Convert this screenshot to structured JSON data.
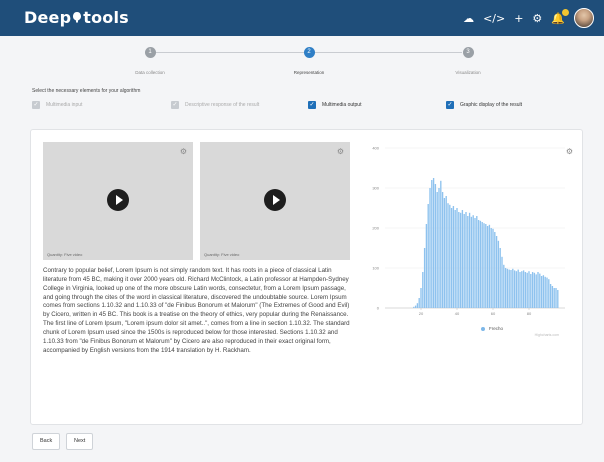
{
  "brand": {
    "name_prefix": "Deep",
    "name_suffix": "tools"
  },
  "topbar": {
    "icons": [
      "cloud-icon",
      "code-icon",
      "plus-icon",
      "settings-icon",
      "bell-icon",
      "avatar"
    ]
  },
  "stepper": {
    "steps": [
      {
        "number": "1",
        "label": "Data collection",
        "state": "done"
      },
      {
        "number": "2",
        "label": "Representation",
        "state": "active"
      },
      {
        "number": "3",
        "label": "Visualization",
        "state": "pending"
      }
    ]
  },
  "instructions": "Select the necessary elements for your algorithm",
  "options": [
    {
      "label": "Multimedia input",
      "checked": false
    },
    {
      "label": "Descriptive response of the result",
      "checked": false
    },
    {
      "label": "Multimedia output",
      "checked": true
    },
    {
      "label": "Graphic display of the result",
      "checked": true
    }
  ],
  "videos": [
    {
      "caption": "Quantity: Five video"
    },
    {
      "caption": "Quantity: Five video"
    }
  ],
  "body_text": "Contrary to popular belief, Lorem Ipsum is not simply random text. It has roots in a piece of classical Latin literature from 45 BC, making it over 2000 years old. Richard McClintock, a Latin professor at Hampden-Sydney College in Virginia, looked up one of the more obscure Latin words, consectetur, from a Lorem Ipsum passage, and going through the cites of the word in classical literature, discovered the undoubtable source. Lorem Ipsum comes from sections 1.10.32 and 1.10.33 of \"de Finibus Bonorum et Malorum\" (The Extremes of Good and Evil) by Cicero, written in 45 BC. This book is a treatise on the theory of ethics, very popular during the Renaissance. The first line of Lorem Ipsum, \"Lorem ipsum dolor sit amet..\", comes from a line in section 1.10.32. The standard chunk of Lorem Ipsum used since the 1500s is reproduced below for those interested. Sections 1.10.32 and 1.10.33 from \"de Finibus Bonorum et Malorum\" by Cicero are also reproduced in their exact original form, accompanied by English versions from the 1914 translation by H. Rackham.",
  "chart_data": {
    "type": "bar",
    "ylim": [
      0,
      400
    ],
    "yticks": [
      "0",
      "100",
      "200",
      "300",
      "400"
    ],
    "xticks": [
      "20",
      "40",
      "60",
      "80"
    ],
    "xlim": [
      0,
      100
    ],
    "legend": "Frecho",
    "legend_position": "bottom",
    "color": "#8ec2ee",
    "credit": "Highcharts.com",
    "x": [
      16,
      17,
      18,
      19,
      20,
      21,
      22,
      23,
      24,
      25,
      26,
      27,
      28,
      29,
      30,
      31,
      32,
      33,
      34,
      35,
      36,
      37,
      38,
      39,
      40,
      41,
      42,
      43,
      44,
      45,
      46,
      47,
      48,
      49,
      50,
      51,
      52,
      53,
      54,
      55,
      56,
      57,
      58,
      59,
      60,
      61,
      62,
      63,
      64,
      65,
      66,
      67,
      68,
      69,
      70,
      71,
      72,
      73,
      74,
      75,
      76,
      77,
      78,
      79,
      80,
      81,
      82,
      83,
      84,
      85,
      86,
      87,
      88,
      89,
      90,
      91,
      92,
      93,
      94,
      95,
      96
    ],
    "values": [
      3,
      6,
      12,
      25,
      50,
      90,
      150,
      210,
      260,
      300,
      320,
      325,
      310,
      290,
      300,
      318,
      290,
      275,
      280,
      262,
      258,
      250,
      255,
      245,
      250,
      240,
      238,
      245,
      235,
      240,
      230,
      238,
      228,
      232,
      225,
      230,
      220,
      218,
      215,
      212,
      210,
      205,
      208,
      200,
      198,
      190,
      180,
      168,
      150,
      128,
      108,
      100,
      98,
      96,
      95,
      98,
      94,
      92,
      96,
      90,
      92,
      94,
      90,
      88,
      92,
      85,
      90,
      88,
      84,
      90,
      86,
      80,
      82,
      78,
      76,
      72,
      60,
      55,
      50,
      50,
      45
    ]
  },
  "buttons": {
    "back": "Back",
    "next": "Next"
  }
}
